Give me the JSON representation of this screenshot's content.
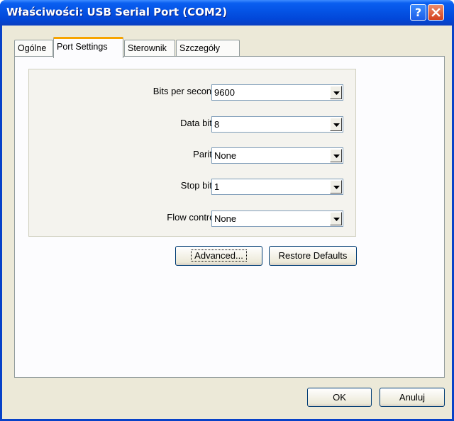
{
  "window": {
    "title": "Właściwości: USB Serial Port (COM2)",
    "help_label": "?"
  },
  "tabs": [
    {
      "label": "Ogólne",
      "active": false
    },
    {
      "label": "Port Settings",
      "active": true
    },
    {
      "label": "Sterownik",
      "active": false
    },
    {
      "label": "Szczegóły",
      "active": false
    }
  ],
  "settings": [
    {
      "label": "Bits per second:",
      "value": "9600"
    },
    {
      "label": "Data bits:",
      "value": "8"
    },
    {
      "label": "Parity:",
      "value": "None"
    },
    {
      "label": "Stop bits:",
      "value": "1"
    },
    {
      "label": "Flow control:",
      "value": "None"
    }
  ],
  "buttons": {
    "advanced": "Advanced...",
    "restore_defaults": "Restore Defaults",
    "ok": "OK",
    "cancel": "Anuluj"
  },
  "colors": {
    "titlebar": "#0554e6",
    "dialog_bg": "#ece9d8",
    "active_tab_accent": "#f7a400"
  },
  "icons": {
    "help": "help-icon",
    "close": "close-icon",
    "dropdown": "chevron-down-icon"
  }
}
